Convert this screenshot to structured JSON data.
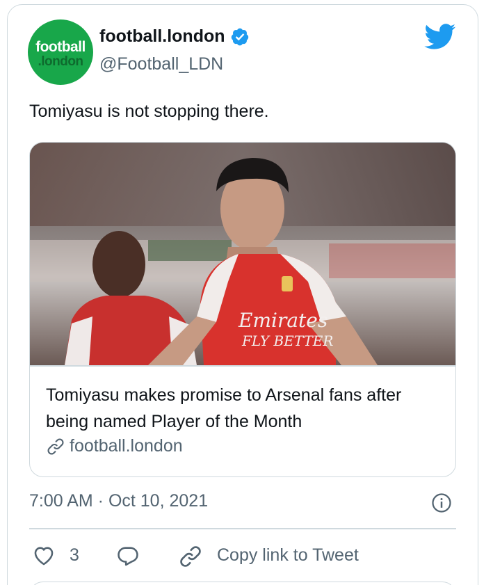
{
  "author": {
    "avatar": {
      "line1": "football",
      "line2": ".london"
    },
    "name": "football.london",
    "handle": "@Football_LDN",
    "verified": true
  },
  "tweet": {
    "text": "Tomiyasu is not stopping there.",
    "timestamp": "7:00 AM · Oct 10, 2021"
  },
  "link_card": {
    "headline": "Tomiyasu makes promise to Arsenal fans after being named Player of the Month",
    "domain": "football.london"
  },
  "actions": {
    "like_count": "3",
    "copy_link_label": "Copy link to Tweet"
  },
  "colors": {
    "twitter_blue": "#1d9bf0",
    "text_primary": "#0f1419",
    "text_secondary": "#536471",
    "border": "#cfd9de",
    "avatar_green": "#18a74a"
  },
  "icons": [
    "verified-badge-icon",
    "twitter-bird-icon",
    "link-icon",
    "info-icon",
    "heart-icon",
    "reply-icon",
    "copy-link-icon"
  ]
}
